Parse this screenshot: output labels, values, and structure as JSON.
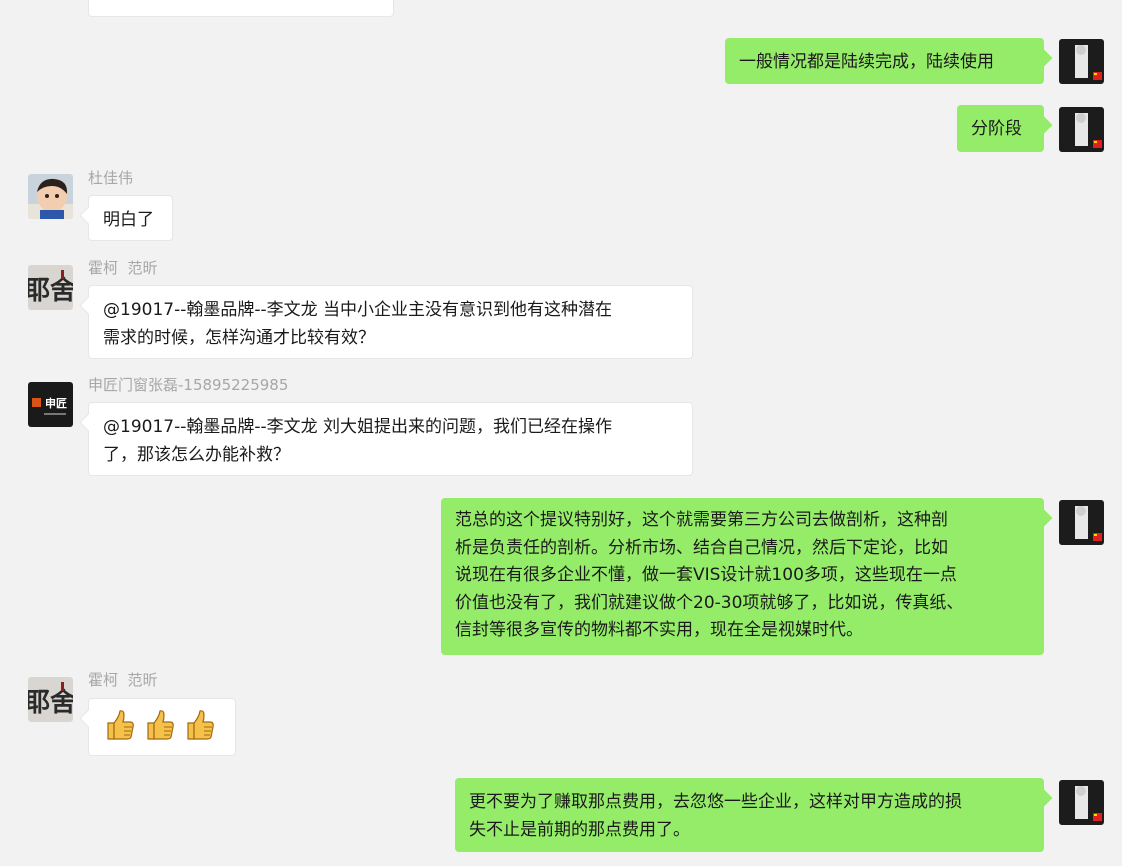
{
  "colors": {
    "background": "#f2f2f2",
    "bubble_self": "#95ec69",
    "bubble_other": "#ffffff",
    "sender_name": "#a7a7a7",
    "emoji_thumb": "#f6c14a"
  },
  "messages": [
    {
      "side": "right",
      "lines": [
        "一般情况都是陆续完成，陆续使用"
      ]
    },
    {
      "side": "right",
      "lines": [
        "分阶段"
      ]
    },
    {
      "side": "left",
      "sender": "杜佳伟",
      "lines": [
        "明白了"
      ]
    },
    {
      "side": "left",
      "sender": "霍柯  范昕",
      "lines": [
        "@19017--翰墨品牌--李文龙 当中小企业主没有意识到他有这种潜在",
        "需求的时候，怎样沟通才比较有效？"
      ]
    },
    {
      "side": "left",
      "sender": "申匠门窗张磊-15895225985",
      "lines": [
        "@19017--翰墨品牌--李文龙 刘大姐提出来的问题，我们已经在操作",
        "了，那该怎么办能补救？"
      ]
    },
    {
      "side": "right",
      "lines": [
        "范总的这个提议特别好，这个就需要第三方公司去做剖析，这种剖",
        "析是负责任的剖析。分析市场、结合自己情况，然后下定论，比如",
        "说现在有很多企业不懂，做一套VIS设计就100多项，这些现在一点",
        "价值也没有了，我们就建议做个20-30项就够了，比如说，传真纸、",
        "信封等很多宣传的物料都不实用，现在全是视媒时代。"
      ]
    },
    {
      "side": "left",
      "sender": "霍柯  范昕",
      "emoji": [
        "thumbs-up",
        "thumbs-up",
        "thumbs-up"
      ]
    },
    {
      "side": "right",
      "lines": [
        "更不要为了赚取那点费用，去忽悠一些企业，这样对甲方造成的损",
        "失不止是前期的那点费用了。"
      ]
    }
  ],
  "avatar_labels": {
    "shenjiang": "申匠",
    "huoke": "耶舍"
  }
}
